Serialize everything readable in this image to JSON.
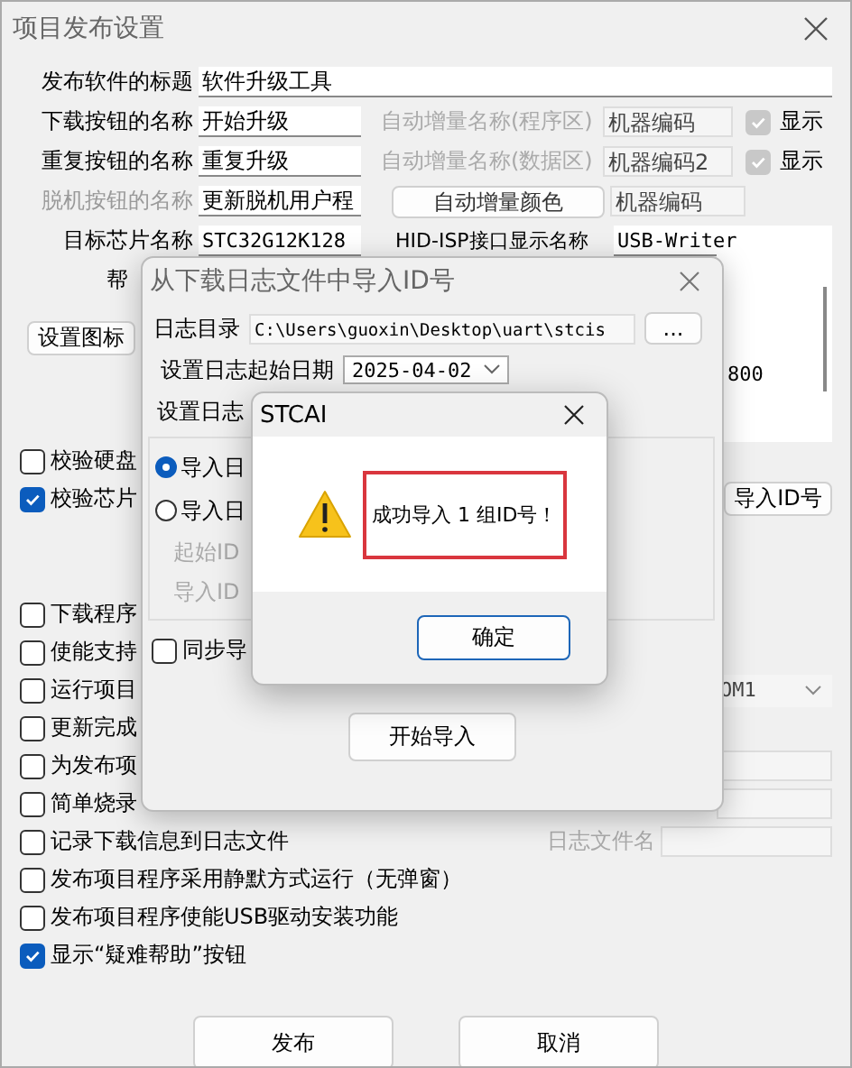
{
  "window": {
    "title": "项目发布设置"
  },
  "title_row": {
    "label": "发布软件的标题",
    "value": "软件升级工具"
  },
  "name_rows": [
    {
      "label": "下载按钮的名称",
      "value": "开始升级",
      "auto_label": "自动增量名称(程序区)",
      "auto_value": "机器编码",
      "show_label": "显示",
      "show_checked": true
    },
    {
      "label": "重复按钮的名称",
      "value": "重复升级",
      "auto_label": "自动增量名称(数据区)",
      "auto_value": "机器编码2",
      "show_label": "显示",
      "show_checked": true
    }
  ],
  "offline_row": {
    "label": "脱机按钮的名称",
    "value": "更新脱机用户程",
    "disabled": true,
    "color_button": "自动增量颜色",
    "color_value": "机器编码"
  },
  "chip_row": {
    "label": "目标芯片名称",
    "value": "STC32G12K128",
    "hid_label": "HID-ISP接口显示名称",
    "hid_value": "USB-Writer"
  },
  "help": {
    "label": "帮",
    "text": "800",
    "icon_button": "设置图标"
  },
  "verify_options": [
    {
      "label": "校验硬盘",
      "checked": false
    },
    {
      "label": "校验芯片",
      "checked": true,
      "button": "导入ID号"
    }
  ],
  "options": [
    {
      "kind": "plain",
      "label": "下载程序",
      "checked": false
    },
    {
      "kind": "plain",
      "label": "使能支持",
      "checked": false
    },
    {
      "kind": "dropdown",
      "label": "运行项目",
      "checked": false,
      "value": "OM1"
    },
    {
      "kind": "plain",
      "label": "更新完成",
      "checked": false
    },
    {
      "kind": "field",
      "label": "为发布项",
      "checked": false
    },
    {
      "kind": "field",
      "label": "简单烧录",
      "checked": false
    },
    {
      "kind": "log",
      "label": "记录下载信息到日志文件",
      "checked": false,
      "field_label": "日志文件名"
    },
    {
      "kind": "plain",
      "label": "发布项目程序采用静默方式运行（无弹窗）",
      "checked": false
    },
    {
      "kind": "plain",
      "label": "发布项目程序使能USB驱动安装功能",
      "checked": false
    },
    {
      "kind": "plain",
      "label": "显示“疑难帮助”按钮",
      "checked": true
    }
  ],
  "buttons": [
    "发布",
    "取消"
  ],
  "import_dialog": {
    "title": "从下载日志文件中导入ID号",
    "dir_label": "日志目录",
    "dir_value": "C:\\Users\\guoxin\\Desktop\\uart\\stcis",
    "browse": "...",
    "date_label": "设置日志起始日期",
    "date_value": "2025-04-02",
    "label_2": "设置日志",
    "radios": [
      {
        "label": "导入日",
        "selected": true
      },
      {
        "label": "导入日",
        "selected": false
      }
    ],
    "disabled_labels": [
      "起始ID",
      "导入ID"
    ],
    "sync": {
      "label": "同步导",
      "checked": false
    },
    "start_button": "开始导入"
  },
  "message_box": {
    "title": "STCAI",
    "message": "成功导入 1 组ID号！",
    "ok": "确定"
  }
}
